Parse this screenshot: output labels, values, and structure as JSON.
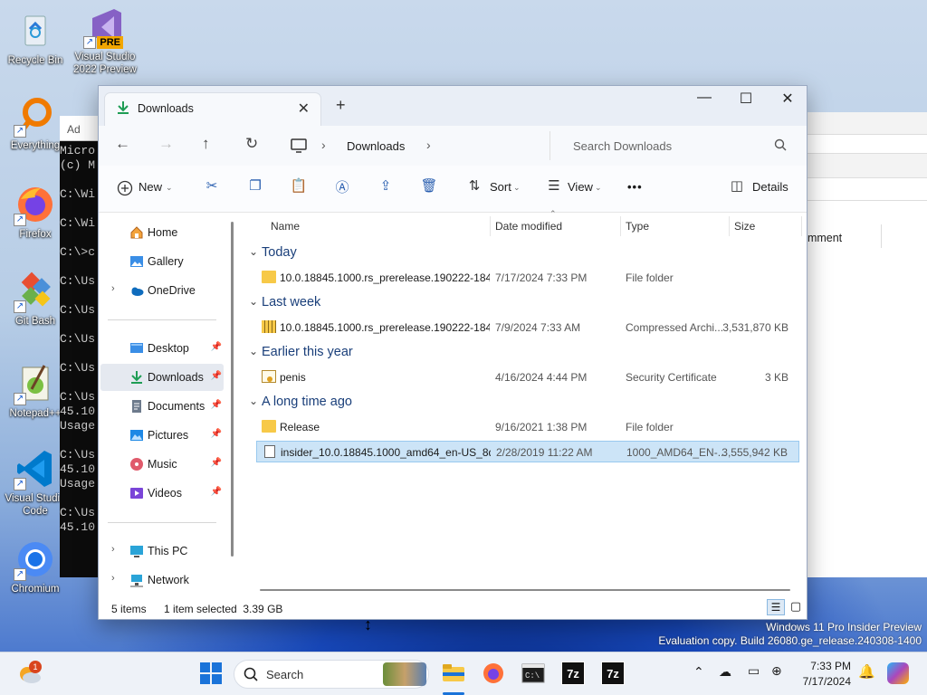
{
  "desktop": {
    "icons": [
      {
        "label": "Recycle Bin",
        "icon": "recycle-bin-icon"
      },
      {
        "label": "Visual Studio 2022 Preview",
        "icon": "visual-studio-icon",
        "badge": "PRE"
      },
      {
        "label": "Everything",
        "icon": "everything-search-icon"
      },
      {
        "label": "Firefox",
        "icon": "firefox-icon"
      },
      {
        "label": "Git Bash",
        "icon": "git-bash-icon"
      },
      {
        "label": "Notepad++",
        "icon": "notepadpp-icon"
      },
      {
        "label": "Visual Studio Code",
        "icon": "vscode-icon"
      },
      {
        "label": "Chromium",
        "icon": "chromium-icon"
      }
    ],
    "watermark_line1": "Windows 11 Pro Insider Preview",
    "watermark_line2": "Evaluation copy. Build 26080.ge_release.240308-1400"
  },
  "console": {
    "title": "Ad",
    "lines": [
      "Micro",
      "(c) M",
      "",
      "C:\\Wi",
      "",
      "C:\\Wi",
      "",
      "C:\\>c",
      "",
      "C:\\Us",
      "",
      "C:\\Us",
      "",
      "C:\\Us",
      "",
      "C:\\Us",
      "",
      "C:\\Us",
      "45.10",
      "Usage",
      "",
      "C:\\Us",
      "45.10",
      "Usage",
      "",
      "C:\\Us",
      "45.10"
    ]
  },
  "background_window": {
    "column_label": "omment"
  },
  "explorer": {
    "tab_title": "Downloads",
    "new_tab": "+",
    "window_controls": {
      "minimize": "—",
      "maximize": "☐",
      "close": "✕"
    },
    "breadcrumb": {
      "location": "Downloads"
    },
    "search": {
      "placeholder": "Search Downloads"
    },
    "toolbar": {
      "new_label": "New",
      "sort_label": "Sort",
      "view_label": "View",
      "more_label": "•••",
      "details_label": "Details"
    },
    "sidebar": {
      "home": "Home",
      "gallery": "Gallery",
      "onedrive": "OneDrive",
      "desktop": "Desktop",
      "downloads": "Downloads",
      "documents": "Documents",
      "pictures": "Pictures",
      "music": "Music",
      "videos": "Videos",
      "thispc": "This PC",
      "network": "Network"
    },
    "columns": {
      "name": "Name",
      "date": "Date modified",
      "type": "Type",
      "size": "Size"
    },
    "groups": [
      {
        "label": "Today",
        "items": [
          {
            "name": "10.0.18845.1000.rs_prerelease.190222-184...",
            "date": "7/17/2024 7:33 PM",
            "type": "File folder",
            "size": "",
            "icon": "folder-icon"
          }
        ]
      },
      {
        "label": "Last week",
        "items": [
          {
            "name": "10.0.18845.1000.rs_prerelease.190222-184...",
            "date": "7/9/2024 7:33 AM",
            "type": "Compressed Archi...",
            "size": "3,531,870 KB",
            "icon": "zip-folder-icon"
          }
        ]
      },
      {
        "label": "Earlier this year",
        "items": [
          {
            "name": "penis",
            "date": "4/16/2024 4:44 PM",
            "type": "Security Certificate",
            "size": "3 KB",
            "icon": "certificate-icon"
          }
        ]
      },
      {
        "label": "A long time ago",
        "items": [
          {
            "name": "Release",
            "date": "9/16/2021 1:38 PM",
            "type": "File folder",
            "size": "",
            "icon": "folder-icon"
          },
          {
            "name": "insider_10.0.18845.1000_amd64_en-US_8d...",
            "date": "2/28/2019 11:22 AM",
            "type": "1000_AMD64_EN-...",
            "size": "3,555,942 KB",
            "icon": "file-icon",
            "selected": true
          }
        ]
      }
    ],
    "status": {
      "items": "5 items",
      "selected": "1 item selected  3.39 GB"
    }
  },
  "taskbar": {
    "search_label": "Search",
    "weather_badge": "1",
    "clock_time": "7:33 PM",
    "clock_date": "7/17/2024",
    "apps": [
      "start-icon",
      "file-explorer-icon",
      "firefox-icon",
      "terminal-icon",
      "7zip-icon",
      "7zip-icon"
    ],
    "sevenzip_label": "7z"
  },
  "colors": {
    "accent": "#0067c0",
    "selection": "#cce4f7",
    "folder": "#f7c948"
  }
}
